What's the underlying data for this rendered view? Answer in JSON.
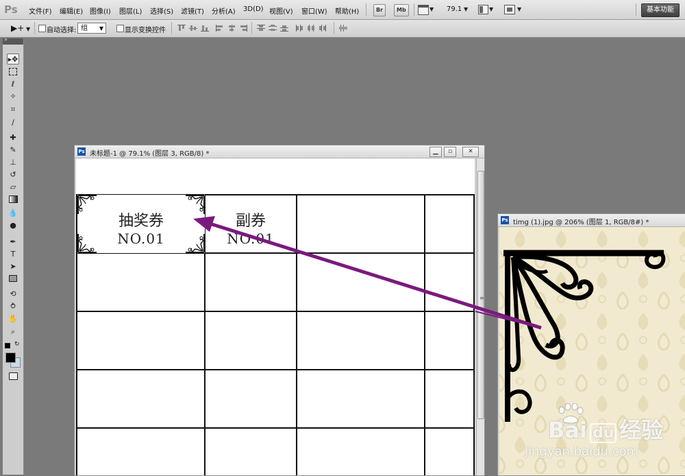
{
  "menubar": {
    "logo": "Ps",
    "items": [
      "文件(F)",
      "编辑(E)",
      "图像(I)",
      "图层(L)",
      "选择(S)",
      "滤镜(T)",
      "分析(A)",
      "3D(D)",
      "视图(V)",
      "窗口(W)",
      "帮助(H)"
    ],
    "bridge_label": "Br",
    "minibridge_label": "Mb",
    "zoom": "79.1",
    "workspace": "基本功能"
  },
  "options": {
    "auto_select_label": "自动选择:",
    "auto_select_value": "组",
    "show_transform_label": "显示变换控件"
  },
  "doc1": {
    "title": "未标题-1 @ 79.1% (图层 3, RGB/8) *",
    "badge": "Ps",
    "ticket_title": "抽奖券",
    "ticket_no": "NO.01",
    "stub_title": "副券",
    "stub_no": "NO.01"
  },
  "doc2": {
    "title": "timg (1).jpg @ 206% (图层 1, RGB/8#) *",
    "badge": "Ps"
  },
  "watermark": {
    "brand": "Bai",
    "brand_suffix": "经验",
    "url": "jingyan.baidu.com"
  },
  "colors": {
    "arrow": "#7b1a7e",
    "accent_blue": "#1a54a6"
  }
}
